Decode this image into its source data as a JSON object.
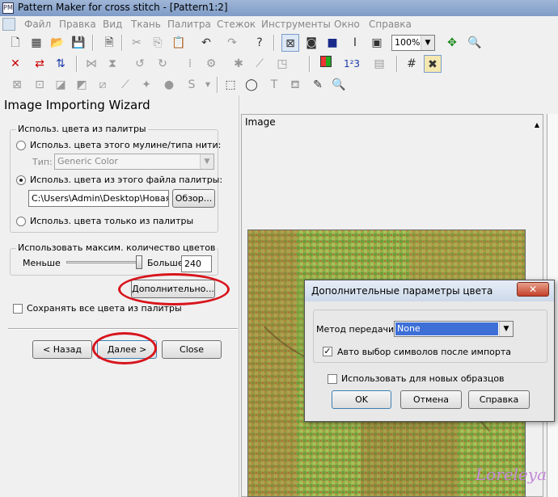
{
  "window": {
    "title": "Pattern Maker for cross stitch - [Pattern1:2]",
    "app_icon": "PM"
  },
  "menu": [
    "Файл",
    "Правка",
    "Вид",
    "Ткань",
    "Палитра",
    "Стежок",
    "Инструменты",
    "Окно",
    "Справка"
  ],
  "toolbar": {
    "zoom_value": "100%",
    "superscript_label": "1²3"
  },
  "wizard": {
    "title": "Image Importing Wizard",
    "palette_group_title": "Использ. цвета из палитры",
    "option_thread": "Использ. цвета этого мулине/типа нити:",
    "type_label": "Тип:",
    "type_value": "Generic Color",
    "option_file": "Использ. цвета из этого файла палитры:",
    "file_path": "C:\\Users\\Admin\\Desktop\\Новая п",
    "browse_label": "Обзор...",
    "option_palette_only": "Использ. цвета только из палитры",
    "max_colors_group_title": "Использовать максим. количество цветов",
    "less_label": "Меньше",
    "more_label": "Больше",
    "max_colors_value": "240",
    "advanced_label": "Дополнительно...",
    "keep_all_label": "Сохранять все цвета из палитры",
    "back_label": "< Назад",
    "next_label": "Далее >",
    "close_label": "Close"
  },
  "image_panel": {
    "title": "Image"
  },
  "dialog": {
    "title": "Дополнительные параметры цвета",
    "method_label": "Метод передачи:",
    "method_value": "None",
    "auto_symbols_label": "Авто выбор символов после импорта",
    "use_new_label": "Использовать для новых образцов",
    "ok_label": "OK",
    "cancel_label": "Отмена",
    "help_label": "Справка"
  },
  "watermark": "Loreleya",
  "colors": {
    "highlight_red": "#d8141c",
    "selection_blue": "#3d6fd6"
  }
}
